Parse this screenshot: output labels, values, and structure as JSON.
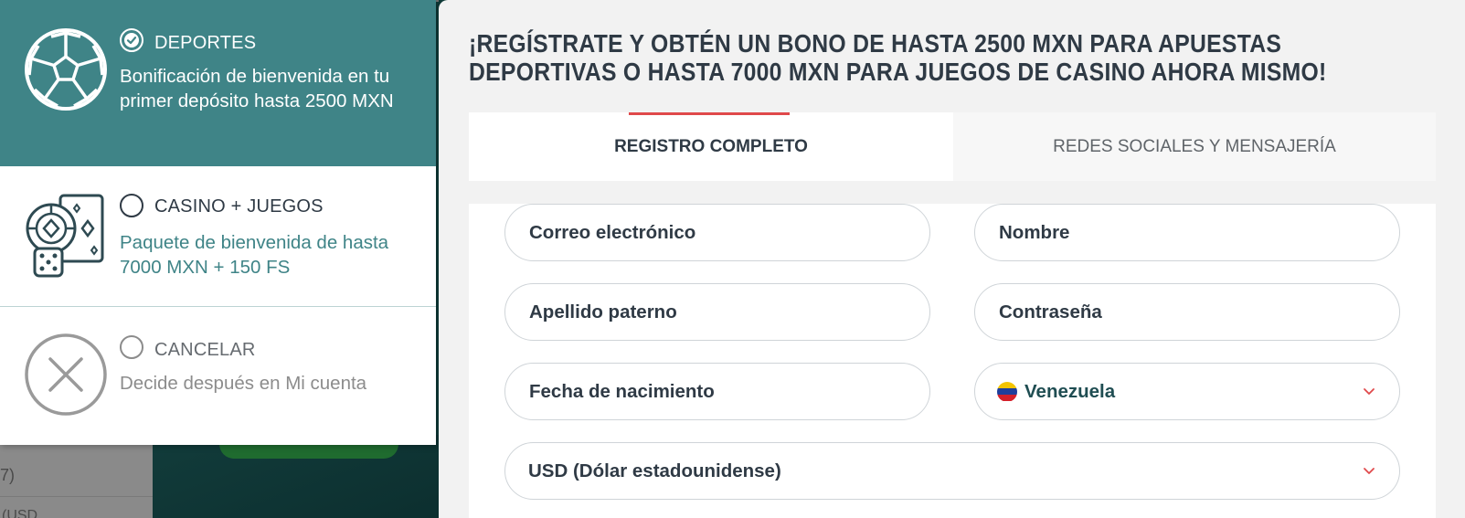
{
  "colors": {
    "teal": "#3f8487",
    "dark_text": "#2f3a45",
    "accent_red": "#e0494b",
    "muted_gray": "#8c8c8c"
  },
  "background_page": {
    "row_text": "7)",
    "row_text_2": "(USD"
  },
  "bonus_panel": {
    "options": [
      {
        "id": "sports",
        "title": "DEPORTES",
        "description": "Bonificación de bienvenida en tu primer depósito hasta 2500 MXN",
        "selected": true,
        "icon": "soccer-ball-icon"
      },
      {
        "id": "casino",
        "title": "CASINO + JUEGOS",
        "description": "Paquete de bienvenida de hasta 7000 MXN + 150 FS",
        "selected": false,
        "icon": "casino-chips-cards-icon"
      },
      {
        "id": "cancel",
        "title": "CANCELAR",
        "description": "Decide después en Mi cuenta",
        "selected": false,
        "icon": "close-circle-icon"
      }
    ]
  },
  "registration": {
    "title": "¡REGÍSTRATE Y OBTÉN UN BONO DE HASTA 2500 MXN PARA APUESTAS DEPORTIVAS O HASTA 7000 MXN PARA JUEGOS DE CASINO AHORA MISMO!",
    "tabs": [
      {
        "label": "REGISTRO COMPLETO",
        "active": true
      },
      {
        "label": "REDES SOCIALES Y MENSAJERÍA",
        "active": false
      }
    ],
    "fields": {
      "email": "Correo electrónico",
      "name": "Nombre",
      "lastname": "Apellido paterno",
      "password": "Contraseña",
      "birthdate": "Fecha de nacimiento",
      "country": "Venezuela",
      "currency": "USD (Dólar estadounidense)"
    }
  }
}
